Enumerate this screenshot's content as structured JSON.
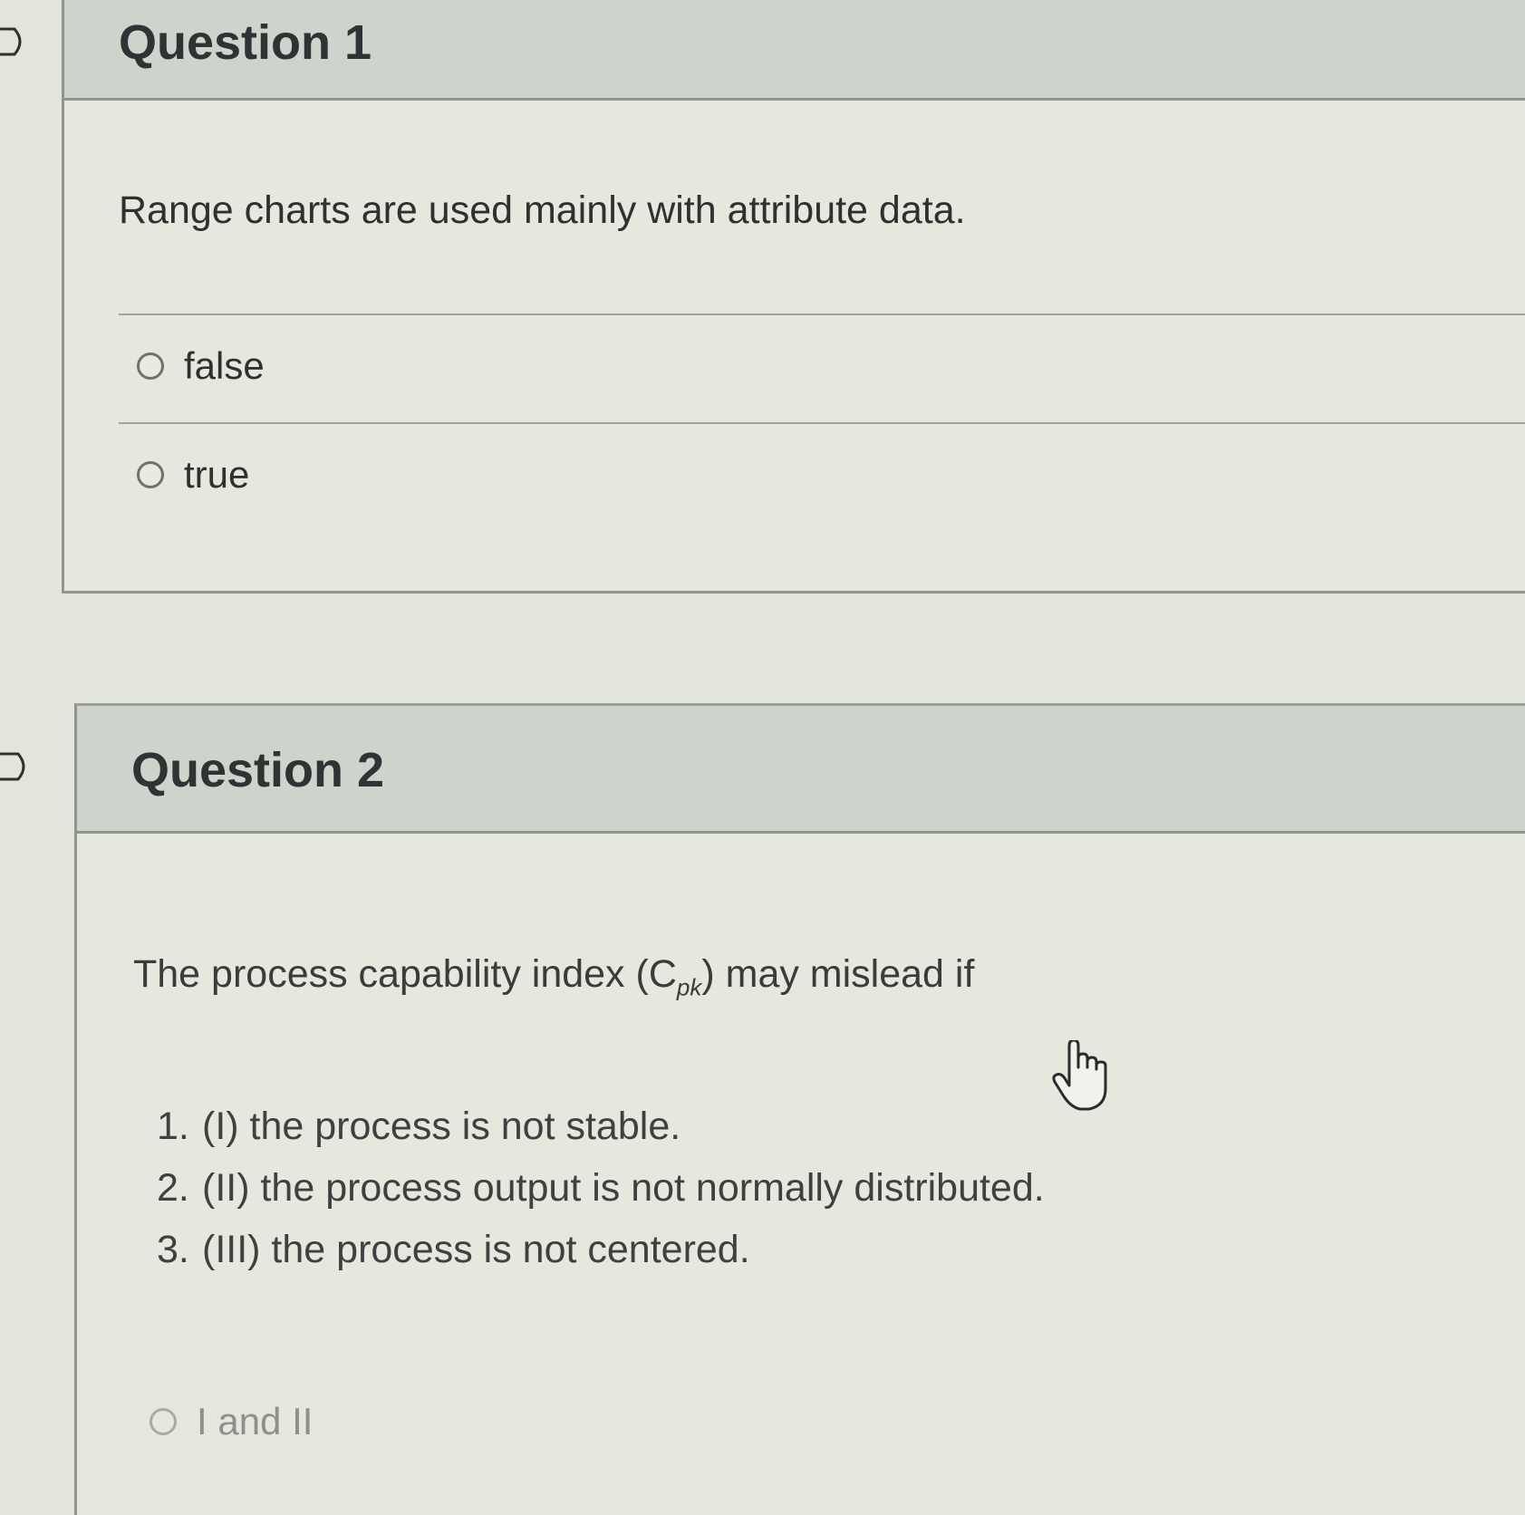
{
  "questions": [
    {
      "title": "Question 1",
      "text": "Range charts are used mainly with attribute data.",
      "options": [
        {
          "label": "false"
        },
        {
          "label": "true"
        }
      ]
    },
    {
      "title": "Question 2",
      "text_before": "The process capability index (C",
      "text_subscript": "pk",
      "text_after": ") may mislead if",
      "conditions": [
        {
          "num": "1.",
          "text": "(I) the process is not stable."
        },
        {
          "num": "2.",
          "text": "(II) the process output is not normally distributed."
        },
        {
          "num": "3.",
          "text": "(III) the process is not centered."
        }
      ],
      "options": [
        {
          "label": "I and II"
        }
      ]
    }
  ],
  "icons": {
    "flag": "flag-icon",
    "cursor": "hand-pointer-icon",
    "radio": "radio-unselected-icon"
  }
}
